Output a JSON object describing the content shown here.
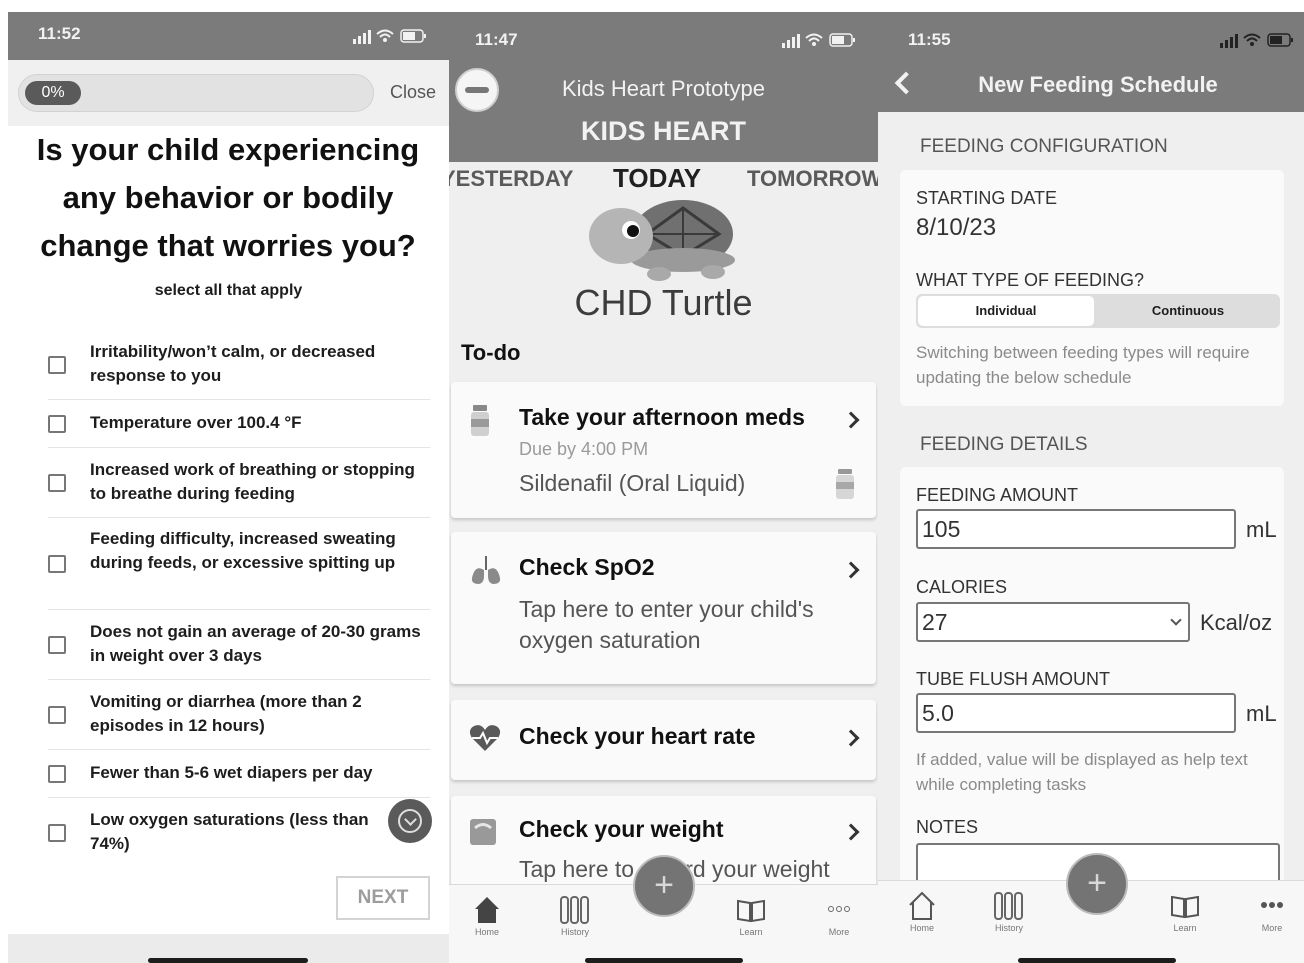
{
  "screen1": {
    "time": "11:52",
    "progress": "0%",
    "close_label": "Close",
    "question": "Is your child experiencing any behavior or bodily change that worries you?",
    "hint": "select all that apply",
    "options": [
      {
        "label": "Irritability/won’t calm, or decreased response to you"
      },
      {
        "label": "Temperature over 100.4 °F"
      },
      {
        "label": "Increased work of breathing or stopping to breathe during feeding"
      },
      {
        "label": "Feeding difficulty, increased sweating during feeds, or excessive spitting up"
      },
      {
        "label": "Does not gain an average of 20-30 grams in weight over 3 days"
      },
      {
        "label": "Vomiting or diarrhea (more than 2 episodes in 12 hours)"
      },
      {
        "label": "Fewer than 5-6 wet diapers per day"
      },
      {
        "label": "Low oxygen saturations (less than 74%)"
      }
    ],
    "next_label": "NEXT"
  },
  "screen2": {
    "time": "11:47",
    "app_title": "Kids Heart Prototype",
    "brand": "KIDS HEART",
    "days": {
      "prev": "YESTERDAY",
      "current": "TODAY",
      "next": "TOMORROW"
    },
    "mascot_name": "CHD Turtle",
    "todo_heading": "To-do",
    "cards": [
      {
        "title": "Take your afternoon meds",
        "due": "Due by 4:00 PM",
        "detail": "Sildenafil (Oral Liquid)"
      },
      {
        "title": "Check SpO2",
        "detail": "Tap here to enter your child's oxygen saturation"
      },
      {
        "title": "Check your heart rate"
      },
      {
        "title": "Check your weight",
        "detail": "Tap here to record your weight"
      }
    ],
    "nav": [
      {
        "label": "Home",
        "icon": "home-icon"
      },
      {
        "label": "History",
        "icon": "history-icon"
      },
      {
        "label": "Learn",
        "icon": "book-icon"
      },
      {
        "label": "More",
        "icon": "more-icon"
      }
    ]
  },
  "screen3": {
    "time": "11:55",
    "title": "New Feeding Schedule",
    "config_heading": "FEEDING CONFIGURATION",
    "starting_date_label": "STARTING DATE",
    "starting_date": "8/10/23",
    "feeding_type_label": "WHAT TYPE OF FEEDING?",
    "feeding_types": [
      "Individual",
      "Continuous"
    ],
    "switch_note": "Switching between feeding types will require updating the below schedule",
    "details_heading": "FEEDING DETAILS",
    "amount_label": "FEEDING AMOUNT",
    "amount_value": "105",
    "amount_unit": "mL",
    "calories_label": "CALORIES",
    "calories_value": "27",
    "calories_unit": "Kcal/oz",
    "flush_label": "TUBE FLUSH AMOUNT",
    "flush_value": "5.0",
    "flush_unit": "mL",
    "flush_help": "If added, value will be displayed as help text while completing tasks",
    "notes_label": "NOTES",
    "nav": [
      {
        "label": "Home",
        "icon": "home-icon"
      },
      {
        "label": "History",
        "icon": "history-icon"
      },
      {
        "label": "Learn",
        "icon": "book-icon"
      },
      {
        "label": "More",
        "icon": "more-icon"
      }
    ]
  },
  "colors": {
    "header_gray": "#7b7b7b",
    "fab_gray": "#747474",
    "background": "#efefef"
  }
}
